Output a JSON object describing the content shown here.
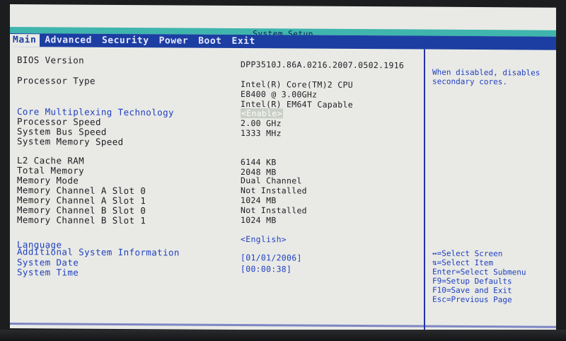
{
  "title": "System Setup",
  "menu": [
    {
      "label": "Main"
    },
    {
      "label": "Advanced"
    },
    {
      "label": "Security"
    },
    {
      "label": "Power"
    },
    {
      "label": "Boot"
    },
    {
      "label": "Exit"
    }
  ],
  "rows": {
    "bios_version": {
      "label": "BIOS Version",
      "value": "DPP3510J.86A.0216.2007.0502.1916"
    },
    "processor_type": {
      "label": "Processor Type",
      "value_lines": [
        "Intel(R) Core(TM)2 CPU",
        "E8400  @ 3.00GHz",
        "Intel(R) EM64T Capable"
      ]
    },
    "core_multiplexing": {
      "label": "Core Multiplexing Technology",
      "value": "<Enable>"
    },
    "processor_speed": {
      "label": "Processor Speed",
      "value": "2.00 GHz"
    },
    "system_bus_speed": {
      "label": "System Bus Speed",
      "value": "1333 MHz"
    },
    "system_memory_speed": {
      "label": "System Memory Speed",
      "value": ""
    },
    "l2_cache": {
      "label": "L2 Cache RAM",
      "value": "6144 KB"
    },
    "total_memory": {
      "label": "Total Memory",
      "value": "2048 MB"
    },
    "memory_mode": {
      "label": "Memory Mode",
      "value": "Dual Channel"
    },
    "mem_a0": {
      "label": "Memory Channel A Slot 0",
      "value": "Not Installed"
    },
    "mem_a1": {
      "label": "Memory Channel A Slot 1",
      "value": "1024 MB"
    },
    "mem_b0": {
      "label": "Memory Channel B Slot 0",
      "value": "Not Installed"
    },
    "mem_b1": {
      "label": "Memory Channel B Slot 1",
      "value": "1024 MB"
    },
    "language": {
      "label": "Language",
      "value": "<English>"
    },
    "additional_info": {
      "label": "Additional System Information"
    },
    "system_date": {
      "label": "System Date",
      "value": "[01/01/2006]"
    },
    "system_time": {
      "label": "System Time",
      "value": "[00:00:38]"
    }
  },
  "help": {
    "text": "When disabled, disables secondary cores.",
    "keys": [
      "↔=Select Screen",
      "⇅=Select Item",
      "Enter=Select Submenu",
      "F9=Setup Defaults",
      "F10=Save and Exit",
      "Esc=Previous Page"
    ]
  },
  "colors": {
    "background": "#e9eae6",
    "menubar": "#1c3ea2",
    "titlebar": "#3fb5ad",
    "text": "#1d1d22",
    "selectable": "#1f3fc0"
  }
}
